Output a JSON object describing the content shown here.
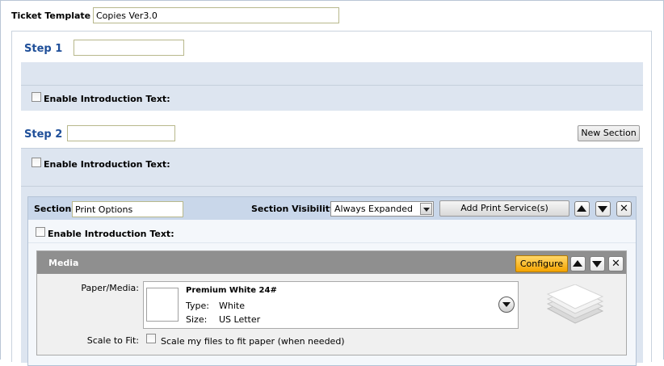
{
  "template": {
    "label": "Ticket Template",
    "name_value": "Copies Ver3.0"
  },
  "step1": {
    "title": "Step 1",
    "name_value": "",
    "enable_intro_label": "Enable Introduction Text:"
  },
  "step2": {
    "title": "Step 2",
    "name_value": "",
    "new_section_label": "New Section",
    "enable_intro_label": "Enable Introduction Text:"
  },
  "section": {
    "label": "Section:",
    "name_value": "Print Options",
    "visibility_label": "Section Visibility:",
    "visibility_selected": "Always Expanded",
    "add_print_service_label": "Add Print Service(s)",
    "enable_intro_label": "Enable Introduction Text:"
  },
  "media": {
    "title": "Media",
    "configure_label": "Configure",
    "paper_media_label": "Paper/Media:",
    "paper": {
      "name": "Premium White 24#",
      "type_key": "Type:",
      "type_value": "White",
      "size_key": "Size:",
      "size_value": "US Letter"
    },
    "scale_label": "Scale to Fit:",
    "scale_option_label": "Scale my files to fit paper (when needed)"
  },
  "icons": {
    "move_up": "arrow-up-icon",
    "move_down": "arrow-down-icon",
    "remove": "close-icon",
    "paper_stack": "paper-stack-icon"
  }
}
